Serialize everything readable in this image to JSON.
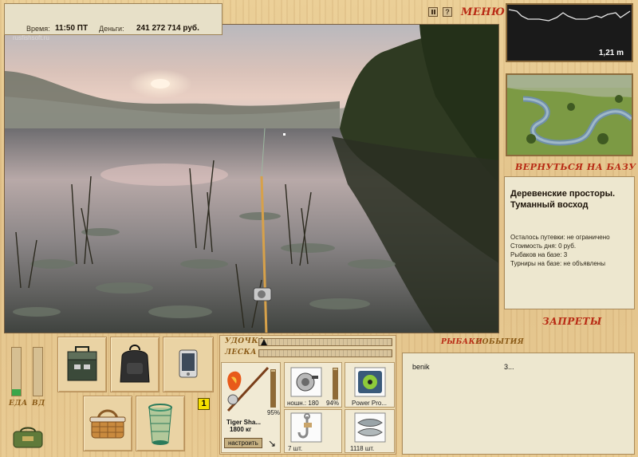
{
  "status": {
    "time_label": "Время:",
    "time_value": "11:50 ПТ",
    "money_label": "Деньги:",
    "money_value": "241 272 714 руб.",
    "watermark": "rusfishsoft.ru"
  },
  "menu": {
    "label": "МЕНЮ",
    "pause_icon": "pause-icon",
    "help_icon": "help-icon",
    "help_glyph": "?"
  },
  "depth": {
    "value": "1,21 m"
  },
  "nav": {
    "return_label": "ВЕРНУТЬСЯ НА БАЗУ",
    "bans_label": "ЗАПРЕТЫ"
  },
  "location": {
    "title": "Деревенские просторы. Туманный восход",
    "lines": [
      "Осталось путевки: не ограничено",
      "Стоимость дня: 0 руб.",
      "Рыбаков на базе: 3",
      "Турниры на базе: не объявлены"
    ]
  },
  "needs": {
    "food_label": "ЕДА",
    "drink_label": "ВД",
    "food_level": 0.14,
    "drink_level": 0.0
  },
  "inventory": {
    "badge": "1"
  },
  "tackle": {
    "rod_label": "УДОЧКА",
    "line_label": "ЛЕСКА",
    "rod_name": "Tiger Sha...",
    "rod_weight": "1800 кг",
    "rod_pct": "95%",
    "reel_name": "ношн.: 180",
    "reel_pct": "94%",
    "line_name": "Power Pro...",
    "hook_count": "7 шт.",
    "bait_count": "1118 шт.",
    "setup_button": "настроить"
  },
  "social": {
    "tab_fishers": "РЫБАКИ",
    "tab_events": "СОБЫТИЯ",
    "rows": [
      {
        "name": "benik",
        "value": "3..."
      }
    ]
  },
  "colors": {
    "title_red": "#b82a14",
    "title_gold": "#8a5a16",
    "meter_green": "#3aa64a"
  }
}
